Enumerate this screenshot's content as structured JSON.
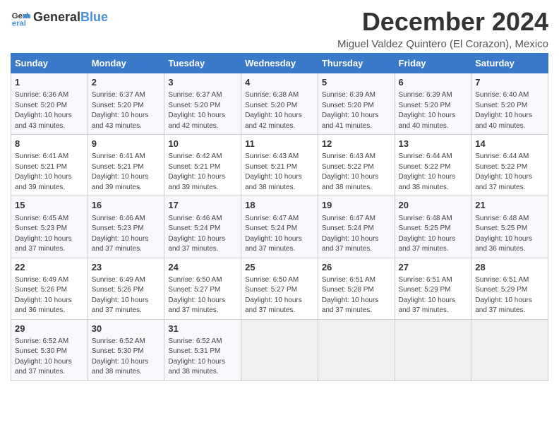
{
  "logo": {
    "general": "General",
    "blue": "Blue"
  },
  "title": "December 2024",
  "location": "Miguel Valdez Quintero (El Corazon), Mexico",
  "headers": [
    "Sunday",
    "Monday",
    "Tuesday",
    "Wednesday",
    "Thursday",
    "Friday",
    "Saturday"
  ],
  "weeks": [
    [
      {
        "day": "1",
        "sunrise": "6:36 AM",
        "sunset": "5:20 PM",
        "daylight": "10 hours and 43 minutes."
      },
      {
        "day": "2",
        "sunrise": "6:37 AM",
        "sunset": "5:20 PM",
        "daylight": "10 hours and 43 minutes."
      },
      {
        "day": "3",
        "sunrise": "6:37 AM",
        "sunset": "5:20 PM",
        "daylight": "10 hours and 42 minutes."
      },
      {
        "day": "4",
        "sunrise": "6:38 AM",
        "sunset": "5:20 PM",
        "daylight": "10 hours and 42 minutes."
      },
      {
        "day": "5",
        "sunrise": "6:39 AM",
        "sunset": "5:20 PM",
        "daylight": "10 hours and 41 minutes."
      },
      {
        "day": "6",
        "sunrise": "6:39 AM",
        "sunset": "5:20 PM",
        "daylight": "10 hours and 40 minutes."
      },
      {
        "day": "7",
        "sunrise": "6:40 AM",
        "sunset": "5:20 PM",
        "daylight": "10 hours and 40 minutes."
      }
    ],
    [
      {
        "day": "8",
        "sunrise": "6:41 AM",
        "sunset": "5:21 PM",
        "daylight": "10 hours and 39 minutes."
      },
      {
        "day": "9",
        "sunrise": "6:41 AM",
        "sunset": "5:21 PM",
        "daylight": "10 hours and 39 minutes."
      },
      {
        "day": "10",
        "sunrise": "6:42 AM",
        "sunset": "5:21 PM",
        "daylight": "10 hours and 39 minutes."
      },
      {
        "day": "11",
        "sunrise": "6:43 AM",
        "sunset": "5:21 PM",
        "daylight": "10 hours and 38 minutes."
      },
      {
        "day": "12",
        "sunrise": "6:43 AM",
        "sunset": "5:22 PM",
        "daylight": "10 hours and 38 minutes."
      },
      {
        "day": "13",
        "sunrise": "6:44 AM",
        "sunset": "5:22 PM",
        "daylight": "10 hours and 38 minutes."
      },
      {
        "day": "14",
        "sunrise": "6:44 AM",
        "sunset": "5:22 PM",
        "daylight": "10 hours and 37 minutes."
      }
    ],
    [
      {
        "day": "15",
        "sunrise": "6:45 AM",
        "sunset": "5:23 PM",
        "daylight": "10 hours and 37 minutes."
      },
      {
        "day": "16",
        "sunrise": "6:46 AM",
        "sunset": "5:23 PM",
        "daylight": "10 hours and 37 minutes."
      },
      {
        "day": "17",
        "sunrise": "6:46 AM",
        "sunset": "5:24 PM",
        "daylight": "10 hours and 37 minutes."
      },
      {
        "day": "18",
        "sunrise": "6:47 AM",
        "sunset": "5:24 PM",
        "daylight": "10 hours and 37 minutes."
      },
      {
        "day": "19",
        "sunrise": "6:47 AM",
        "sunset": "5:24 PM",
        "daylight": "10 hours and 37 minutes."
      },
      {
        "day": "20",
        "sunrise": "6:48 AM",
        "sunset": "5:25 PM",
        "daylight": "10 hours and 37 minutes."
      },
      {
        "day": "21",
        "sunrise": "6:48 AM",
        "sunset": "5:25 PM",
        "daylight": "10 hours and 36 minutes."
      }
    ],
    [
      {
        "day": "22",
        "sunrise": "6:49 AM",
        "sunset": "5:26 PM",
        "daylight": "10 hours and 36 minutes."
      },
      {
        "day": "23",
        "sunrise": "6:49 AM",
        "sunset": "5:26 PM",
        "daylight": "10 hours and 37 minutes."
      },
      {
        "day": "24",
        "sunrise": "6:50 AM",
        "sunset": "5:27 PM",
        "daylight": "10 hours and 37 minutes."
      },
      {
        "day": "25",
        "sunrise": "6:50 AM",
        "sunset": "5:27 PM",
        "daylight": "10 hours and 37 minutes."
      },
      {
        "day": "26",
        "sunrise": "6:51 AM",
        "sunset": "5:28 PM",
        "daylight": "10 hours and 37 minutes."
      },
      {
        "day": "27",
        "sunrise": "6:51 AM",
        "sunset": "5:29 PM",
        "daylight": "10 hours and 37 minutes."
      },
      {
        "day": "28",
        "sunrise": "6:51 AM",
        "sunset": "5:29 PM",
        "daylight": "10 hours and 37 minutes."
      }
    ],
    [
      {
        "day": "29",
        "sunrise": "6:52 AM",
        "sunset": "5:30 PM",
        "daylight": "10 hours and 37 minutes."
      },
      {
        "day": "30",
        "sunrise": "6:52 AM",
        "sunset": "5:30 PM",
        "daylight": "10 hours and 38 minutes."
      },
      {
        "day": "31",
        "sunrise": "6:52 AM",
        "sunset": "5:31 PM",
        "daylight": "10 hours and 38 minutes."
      },
      null,
      null,
      null,
      null
    ]
  ]
}
